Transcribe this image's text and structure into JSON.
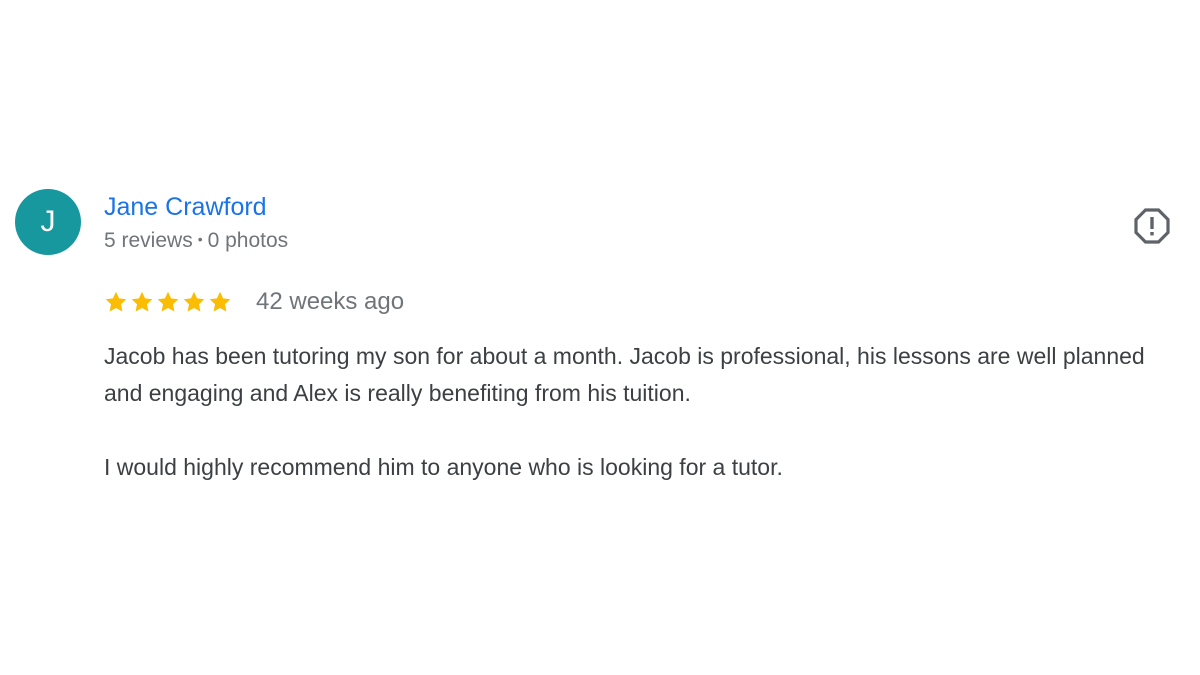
{
  "review": {
    "avatar_initial": "J",
    "author_name": "Jane Crawford",
    "reviews_count": "5 reviews",
    "meta_separator": "•",
    "photos_count": "0 photos",
    "rating": 5,
    "rating_max": 5,
    "date": "42 weeks ago",
    "paragraphs": [
      "Jacob has been tutoring my son for about a month. Jacob is professional, his lessons are well planned and engaging and Alex is really benefiting from his tuition.",
      "I would highly recommend him to anyone who is looking for a tutor."
    ],
    "icons": {
      "report": "report-flag-icon",
      "star": "star-icon"
    }
  },
  "colors": {
    "avatar_bg": "#17989f",
    "author_link": "#1a73e8",
    "meta_text": "#70757a",
    "body_text": "#3c4043",
    "star": "#fbbc04",
    "report_icon": "#5f6368"
  }
}
